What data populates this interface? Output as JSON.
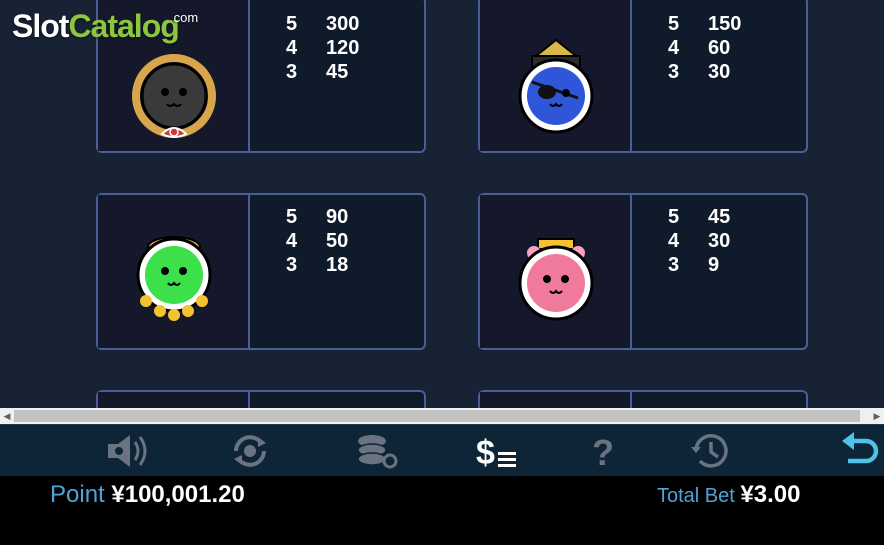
{
  "logo": {
    "part1": "Slot",
    "part2": "Catalog",
    "suffix": ".com"
  },
  "paytable": {
    "symbols": [
      {
        "name": "black-face-symbol",
        "pays": [
          {
            "count": "5",
            "value": "300"
          },
          {
            "count": "4",
            "value": "120"
          },
          {
            "count": "3",
            "value": "45"
          }
        ]
      },
      {
        "name": "blue-face-symbol",
        "pays": [
          {
            "count": "5",
            "value": "150"
          },
          {
            "count": "4",
            "value": "60"
          },
          {
            "count": "3",
            "value": "30"
          }
        ]
      },
      {
        "name": "green-face-symbol",
        "pays": [
          {
            "count": "5",
            "value": "90"
          },
          {
            "count": "4",
            "value": "50"
          },
          {
            "count": "3",
            "value": "18"
          }
        ]
      },
      {
        "name": "pink-face-symbol",
        "pays": [
          {
            "count": "5",
            "value": "45"
          },
          {
            "count": "4",
            "value": "30"
          },
          {
            "count": "3",
            "value": "9"
          }
        ]
      }
    ]
  },
  "toolbar": {
    "buttons": [
      {
        "icon": "sound-icon"
      },
      {
        "icon": "autoplay-icon"
      },
      {
        "icon": "bet-settings-icon"
      },
      {
        "icon": "paytable-icon"
      },
      {
        "icon": "help-icon"
      },
      {
        "icon": "history-icon"
      },
      {
        "icon": "back-icon"
      }
    ]
  },
  "status": {
    "point_label": "Point",
    "point_value": "¥100,001.20",
    "total_bet_label": "Total Bet",
    "total_bet_value": "¥3.00"
  },
  "colors": {
    "accent_blue": "#4fa3d9",
    "card_border": "#4a5f95",
    "logo_green": "#8cc63f",
    "active_cyan": "#4ec3e8"
  }
}
